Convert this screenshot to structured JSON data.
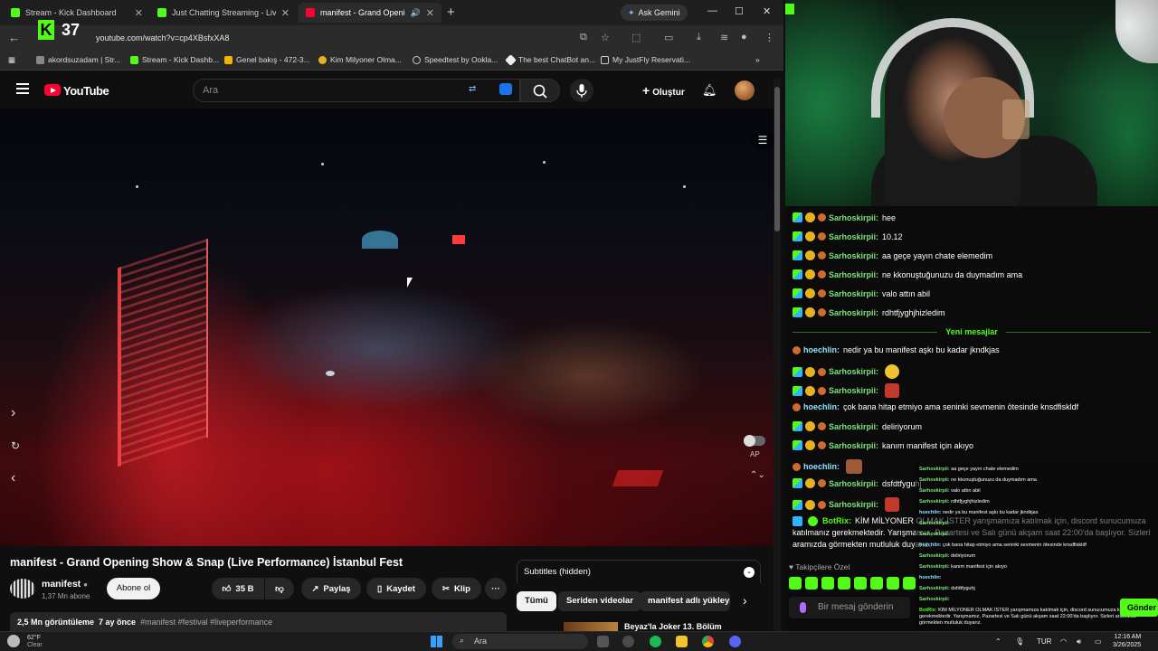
{
  "browser": {
    "tabs": [
      {
        "title": "Stream - Kick Dashboard"
      },
      {
        "title": "Just Chatting Streaming - Live S"
      },
      {
        "title": "manifest - Grand Opening"
      }
    ],
    "ask_gemini": "Ask Gemini",
    "kick_badge": "K",
    "viewer_overlay_count": "37",
    "url": "youtube.com/watch?v=cp4XBsfxXA8",
    "bookmarks": [
      "akordsuzadam | Str...",
      "Stream - Kick Dashb...",
      "Genel bakış - 472-3...",
      "Kim Milyoner Olma...",
      "Speedtest by Ookla...",
      "The best ChatBot an...",
      "My JustFly Reservati..."
    ]
  },
  "youtube": {
    "logo_text": "YouTube",
    "search_placeholder": "Ara",
    "create_label": "Oluştur",
    "video": {
      "title": "manifest - Grand Opening Show & Snap (Live Performance) İstanbul Fest",
      "autoplay_label": "AP"
    },
    "channel": {
      "name": "manifest",
      "subscribers": "1,37 Mn abone",
      "subscribe_label": "Abone ol"
    },
    "actions": {
      "likes": "35 B",
      "share": "Paylaş",
      "save": "Kaydet",
      "clip": "Klip",
      "more": "···"
    },
    "description": {
      "views": "2,5 Mn görüntüleme",
      "age": "7 ay önce",
      "tags": "#manifest #festival #liveperformance"
    },
    "subtitles_panel": "Subtitles (hidden)",
    "chips": [
      "Tümü",
      "Seriden videolar",
      "manifest adlı yükleyi"
    ],
    "next_video_title": "Beyaz'la Joker 13. Bölüm"
  },
  "chat": {
    "messages": [
      {
        "user": "Sarhoskirpii:",
        "text": "hee"
      },
      {
        "user": "Sarhoskirpii:",
        "text": "10.12"
      },
      {
        "user": "Sarhoskirpii:",
        "text": "aa geçe yayın chate elemedim"
      },
      {
        "user": "Sarhoskirpii:",
        "text": "ne kkonuştuğunuzu da duymadım ama"
      },
      {
        "user": "Sarhoskirpii:",
        "text": "valo attın abil"
      },
      {
        "user": "Sarhoskirpii:",
        "text": "rdhtfjyghjhizledim"
      }
    ],
    "new_messages_label": "Yeni mesajlar",
    "messages_after": [
      {
        "user": "hoechlin:",
        "text": "nedir ya bu manifest aşkı bu kadar jkndkjas"
      },
      {
        "user": "Sarhoskirpii:",
        "text": ""
      },
      {
        "user": "Sarhoskirpii:",
        "text": ""
      },
      {
        "user": "hoechlin:",
        "text": "çok bana hitap etmiyo ama seninki sevmenin ötesinde knsdfiskldf"
      },
      {
        "user": "Sarhoskirpii:",
        "text": "deliriyorum"
      },
      {
        "user": "Sarhoskirpii:",
        "text": "kanım manifest için akıyo"
      },
      {
        "user": "hoechlin:",
        "text": ""
      },
      {
        "user": "Sarhoskirpii:",
        "text": "dsfdtfyguhj"
      },
      {
        "user": "Sarhoskirpii:",
        "text": ""
      }
    ],
    "bot_message": {
      "user": "BotRix:",
      "text": "KİM MİLYONER OLMAK İSTER yarışmamıza katılmak için, discord sunucumuza katılmanız gerekmektedir. Yarışmamız, Pazartesi ve Salı günü akşam saat 22:00'da başlıyor. Sizleri aramızda görmekten mutluluk duyarız."
    },
    "overlay_lines": [
      {
        "user": "Sarhoskirpii:",
        "text": "aa geçe yayın chate elemedim"
      },
      {
        "user": "Sarhoskirpii:",
        "text": "ne kkonuştuğunuzu da duymadım ama"
      },
      {
        "user": "Sarhoskirpii:",
        "text": "valo attın abil"
      },
      {
        "user": "Sarhoskirpii:",
        "text": "rdhtfjyghjhizledim"
      },
      {
        "user": "hoechlin:",
        "text": "nedir ya bu manifest aşkı bu kadar jkndkjas"
      },
      {
        "user": "Sarhoskirpii:",
        "text": ""
      },
      {
        "user": "Sarhoskirpii:",
        "text": ""
      },
      {
        "user": "hoechlin:",
        "text": "çok bana hitap etmiyo ama seninki sevmenin ötesinde knsdfiskldf"
      },
      {
        "user": "Sarhoskirpii:",
        "text": "deliriyorum"
      },
      {
        "user": "Sarhoskirpii:",
        "text": "kanım manifest için akıyo"
      },
      {
        "user": "hoechlin:",
        "text": ""
      },
      {
        "user": "Sarhoskirpii:",
        "text": "dsfdtfyguhj"
      },
      {
        "user": "Sarhoskirpii:",
        "text": ""
      },
      {
        "user": "BotRix:",
        "text": "KİM MİLYONER OLMAK İSTER yarışmamıza katılmak için, discord sunucumuza katılmanız gerekmektedir. Yarışmamız, Pazartesi ve Salı günü akşam saat 22:00'da başlıyor. Sizleri aramızda görmekten mutluluk duyarız."
      }
    ],
    "followers_only": "Takipçilere Özel",
    "input_placeholder": "Bir mesaj gönderin",
    "send_label": "Gönder"
  },
  "taskbar": {
    "temperature": "62°F",
    "weather": "Clear",
    "search": "Ara",
    "language": "TUR",
    "time": "12:16 AM",
    "date": "3/26/2025"
  },
  "colors": {
    "kick_green": "#53fc18",
    "youtube_red": "#ff0033",
    "username_green": "#7fe27a"
  }
}
